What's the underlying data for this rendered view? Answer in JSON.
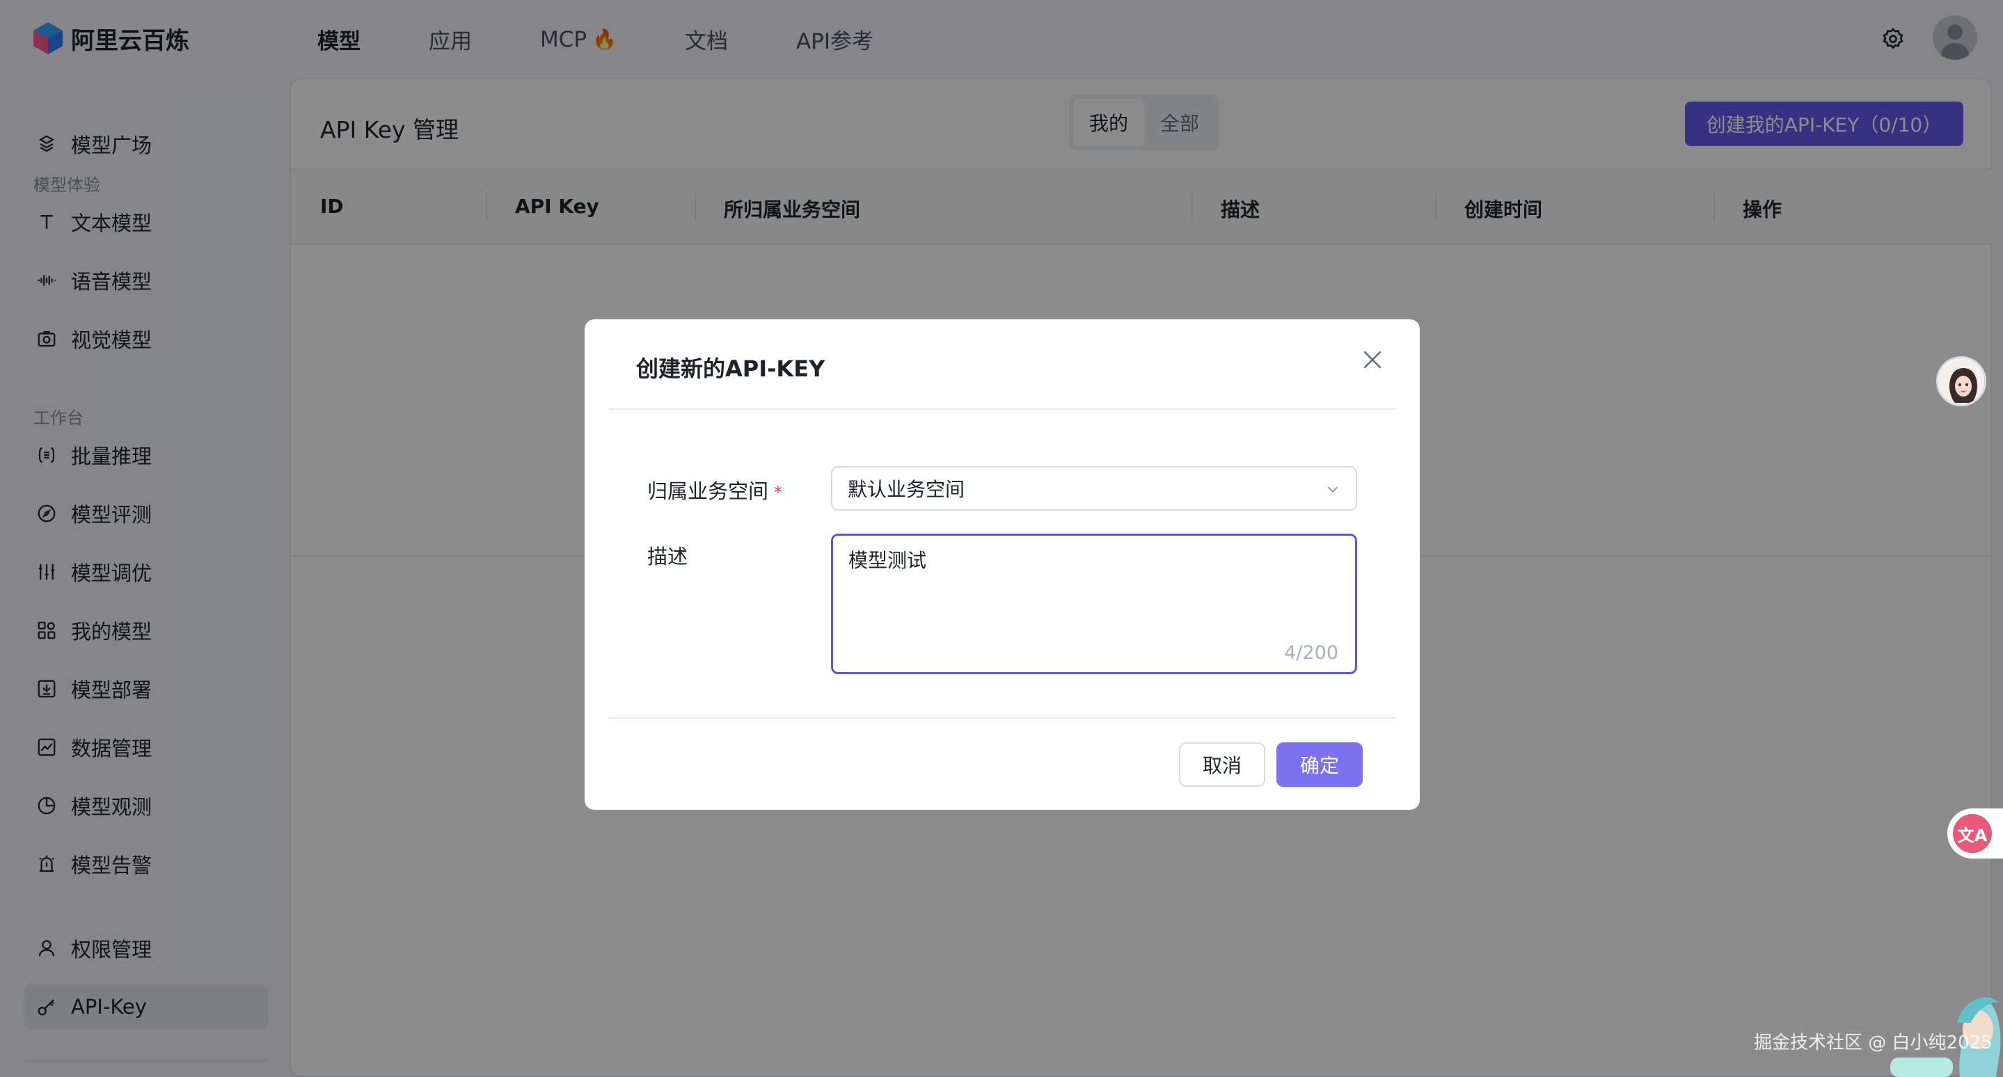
{
  "app": {
    "name": "阿里云百炼"
  },
  "nav": {
    "items": [
      {
        "label": "模型",
        "active": true
      },
      {
        "label": "应用"
      },
      {
        "label": "MCP",
        "icon": "fire-icon"
      },
      {
        "label": "文档"
      },
      {
        "label": "API参考"
      }
    ]
  },
  "sidebar": {
    "top": {
      "label": "模型广场",
      "icon": "model-plaza-icon"
    },
    "group1": {
      "label": "模型体验"
    },
    "group1_items": [
      {
        "label": "文本模型",
        "icon": "text-icon"
      },
      {
        "label": "语音模型",
        "icon": "audio-wave-icon"
      },
      {
        "label": "视觉模型",
        "icon": "camera-icon"
      }
    ],
    "group2": {
      "label": "工作台"
    },
    "group2_items": [
      {
        "label": "批量推理",
        "icon": "batch-icon"
      },
      {
        "label": "模型评测",
        "icon": "compass-icon"
      },
      {
        "label": "模型调优",
        "icon": "sliders-icon"
      },
      {
        "label": "我的模型",
        "icon": "grid-icon"
      },
      {
        "label": "模型部署",
        "icon": "deploy-icon"
      },
      {
        "label": "数据管理",
        "icon": "chart-icon"
      },
      {
        "label": "模型观测",
        "icon": "pie-icon"
      },
      {
        "label": "模型告警",
        "icon": "alarm-icon"
      }
    ],
    "bottom_items": [
      {
        "label": "权限管理",
        "icon": "user-icon"
      },
      {
        "label": "API-Key",
        "icon": "key-icon",
        "active": true
      }
    ]
  },
  "main": {
    "title": "API Key 管理",
    "segment": {
      "mine": "我的",
      "all": "全部",
      "selected": "mine"
    },
    "create_button": "创建我的API-KEY（0/10）",
    "table": {
      "columns": [
        "ID",
        "API Key",
        "所归属业务空间",
        "描述",
        "创建时间",
        "操作"
      ]
    }
  },
  "modal": {
    "title": "创建新的API-KEY",
    "workspace_label": "归属业务空间",
    "required_mark": "*",
    "workspace_value": "默认业务空间",
    "description_label": "描述",
    "description_value": "模型测试",
    "description_counter": "4/200",
    "cancel": "取消",
    "confirm": "确定"
  },
  "watermark": "掘金技术社区 @ 白小纯2025",
  "colors": {
    "primary": "#615ced",
    "confirm": "#7a72f0",
    "required": "#e5484d"
  }
}
